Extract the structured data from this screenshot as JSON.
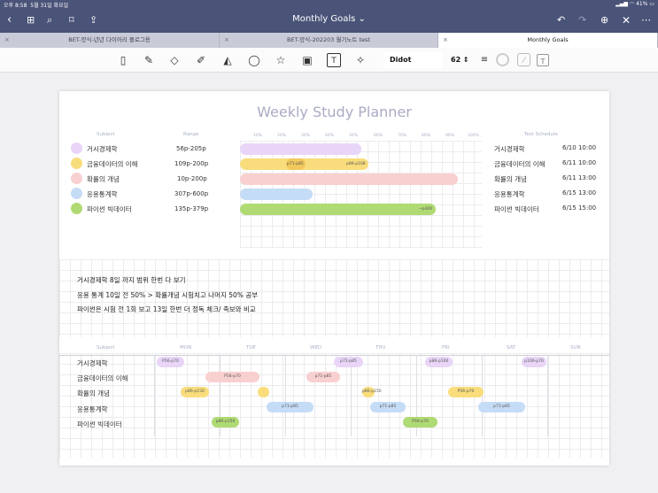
{
  "status": {
    "time": "오후 8:58",
    "date": "5월 31일 화요일",
    "battery": "41%"
  },
  "nav": {
    "title": "Monthly Goals"
  },
  "tabs": [
    {
      "label": "BET-양식-년년 다이어리 플로그용"
    },
    {
      "label": "BET-양식-202203 월기노트 test"
    },
    {
      "label": "Monthly Goals"
    }
  ],
  "toolbar": {
    "font": "Didot",
    "size": "62"
  },
  "planner": {
    "title": "Weekly Study Planner",
    "headers": {
      "subject": "Subject",
      "range": "Range",
      "test": "Test Schedule"
    },
    "percent_ticks": [
      "10%",
      "20%",
      "30%",
      "40%",
      "50%",
      "60%",
      "70%",
      "80%",
      "90%",
      "100%"
    ],
    "colors": {
      "purple": "#e8d5f7",
      "yellow": "#f9dd7c",
      "pink": "#f9d0d0",
      "blue": "#c5dcf6",
      "green": "#b0da74"
    },
    "subjects": [
      {
        "name": "거시경제학",
        "range": "56p-205p",
        "test": "6/10 10:00",
        "progress": 0.5
      },
      {
        "name": "금융데이터의 이해",
        "range": "109p-200p",
        "test": "6/11 10:00",
        "progress": 0.53
      },
      {
        "name": "확률의 개념",
        "range": "10p-200p",
        "test": "6/11 13:00",
        "progress": 0.9
      },
      {
        "name": "응용통계학",
        "range": "307p-600p",
        "test": "6/15 13:00",
        "progress": 0.3
      },
      {
        "name": "파이썬 빅데이터",
        "range": "135p-379p",
        "test": "6/15 15:00",
        "progress": 0.81
      }
    ],
    "bar_labels": {
      "b1": "p71-p85",
      "b2": "p86-p108",
      "b3": "~p300"
    },
    "memo": [
      "거시경제학 8일 까지 범위 한번 다 보기",
      "응용 통계 10일 전 50% > 확률개념 시험치고 나머지 50% 공부",
      "파이썬은 시험 전 1회 보고 13일 한번 더 정독 체크/ 족보와 비교"
    ],
    "weekly_header": {
      "subject": "Subject",
      "days": [
        "MON",
        "TUE",
        "WED",
        "THU",
        "FRI",
        "SAT",
        "SUN"
      ]
    },
    "weekly_subjects": [
      "거시경제학",
      "금융데이터의 이해",
      "확률의 개념",
      "응용통계학",
      "파이썬 빅데이터"
    ],
    "pills": {
      "p1": "P56-p70",
      "p2": "p71-p85",
      "p3": "p86-p100",
      "p4": "p100-p70",
      "p5": "P56-p70",
      "p6": "p71-p85",
      "p7": "p86-p150",
      "p8": "p86-p150",
      "p9": "P56-p70",
      "p10": "p71-p85",
      "p11": "p71-p85",
      "p12": "p71-p85",
      "p13": "p86-p150",
      "p14": "P56-p70"
    }
  }
}
